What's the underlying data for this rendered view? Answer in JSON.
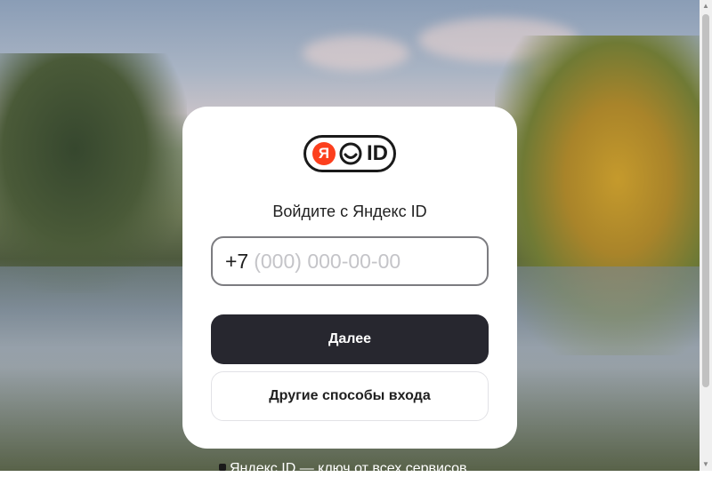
{
  "logo": {
    "badge_letter": "Я",
    "id_text": "ID"
  },
  "login": {
    "title": "Войдите с Яндекс ID",
    "phone_prefix": "+7",
    "phone_placeholder": "(000) 000-00-00",
    "next_button": "Далее",
    "other_methods_button": "Другие способы входа"
  },
  "footer": {
    "tagline": "Яндекс ID — ключ от всех сервисов"
  },
  "colors": {
    "brand_red": "#fc3f1d",
    "primary_button": "#27272f"
  }
}
